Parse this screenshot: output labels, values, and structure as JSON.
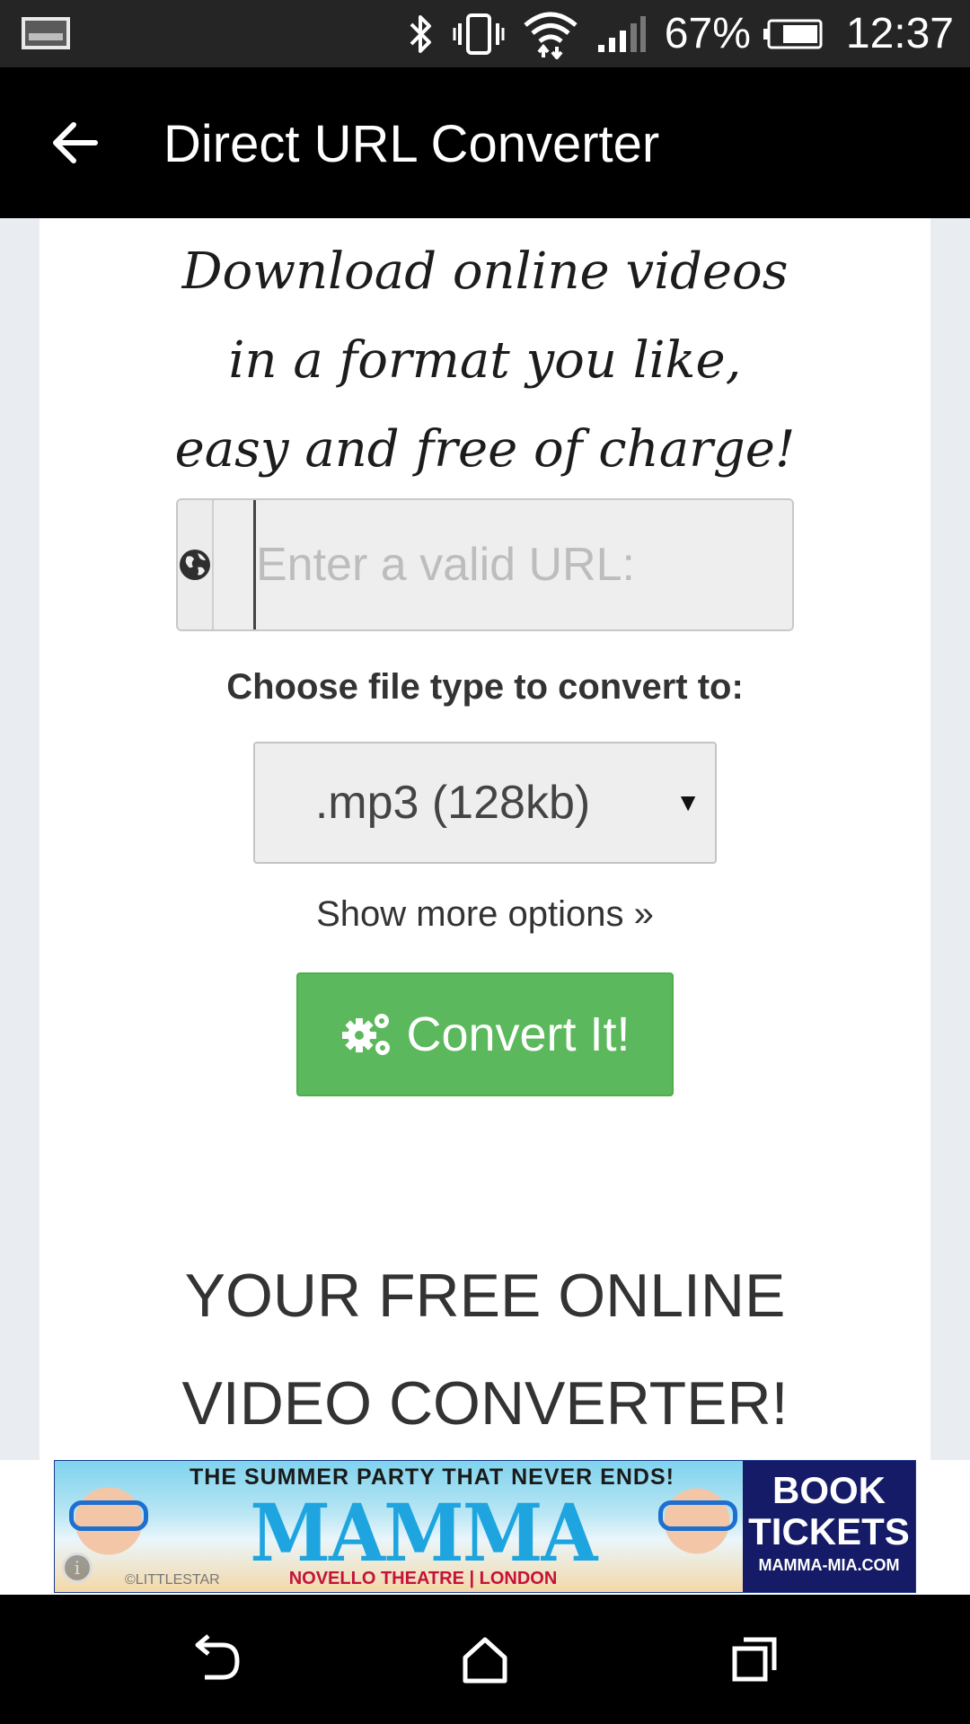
{
  "status_bar": {
    "battery_percent": "67%",
    "time": "12:37",
    "icons": [
      "screenshot-icon",
      "bluetooth-icon",
      "vibrate-icon",
      "wifi-icon",
      "signal-icon",
      "battery-icon"
    ]
  },
  "app_bar": {
    "title": "Direct URL Converter",
    "back_icon": "arrow-left-icon"
  },
  "main": {
    "tagline_lines": [
      "Download online videos",
      "in a format you like,",
      "easy and free of charge!"
    ],
    "url_input": {
      "placeholder": "Enter a valid URL:",
      "value": "",
      "icon": "globe-icon"
    },
    "filetype_label": "Choose file type to convert to:",
    "filetype_select": {
      "selected": ".mp3 (128kb)",
      "arrow": "▼"
    },
    "more_options": "Show more options »",
    "convert_button": {
      "label": "Convert It!",
      "icon": "gears-icon",
      "color": "#5cb85c"
    },
    "headline_lines": [
      "YOUR FREE ONLINE",
      "VIDEO CONVERTER!"
    ]
  },
  "ad": {
    "top_line": "THE SUMMER PARTY THAT NEVER ENDS!",
    "title": "MAMMA MIA!",
    "subline": "NOVELLO THEATRE | LONDON",
    "credit": "©LITTLESTAR",
    "cta_line1": "BOOK",
    "cta_line2": "TICKETS",
    "cta_url": "MAMMA-MIA.COM",
    "info_glyph": "i"
  },
  "nav_bar": {
    "buttons": [
      "back-icon",
      "home-icon",
      "recents-icon"
    ]
  }
}
